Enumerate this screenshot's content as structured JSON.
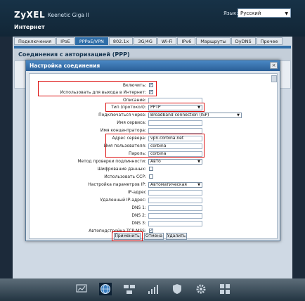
{
  "header": {
    "brand": "ZyXEL",
    "model": "Keenetic Giga II",
    "section": "Интернет",
    "language_label": "Язык:",
    "language_value": "Русский"
  },
  "tabs": [
    {
      "label": "Подключения",
      "active": false
    },
    {
      "label": "IPoE",
      "active": false
    },
    {
      "label": "PPPoE/VPN",
      "active": true
    },
    {
      "label": "802.1x",
      "active": false
    },
    {
      "label": "3G/4G",
      "active": false
    },
    {
      "label": "Wi-Fi",
      "active": false
    },
    {
      "label": "IPv6",
      "active": false
    },
    {
      "label": "Маршруты",
      "active": false
    },
    {
      "label": "DyDNS",
      "active": false
    },
    {
      "label": "Прочее",
      "active": false
    }
  ],
  "panel_title": "Соединения с авторизацией (PPP)",
  "dialog": {
    "title": "Настройка соединения",
    "close": "×",
    "fields": {
      "enable": {
        "label": "Включить:",
        "checked": true
      },
      "use_for_internet": {
        "label": "Использовать для выхода в Интернет:",
        "checked": true
      },
      "description": {
        "label": "Описание:",
        "value": ""
      },
      "protocol": {
        "label": "Тип (протокол):",
        "value": "PPTP"
      },
      "connect_via": {
        "label": "Подключаться через:",
        "value": "Broadband connection (ISP)"
      },
      "service_name": {
        "label": "Имя сервиса:",
        "value": ""
      },
      "concentrator_name": {
        "label": "Имя концентратора:",
        "value": ""
      },
      "server_address": {
        "label": "Адрес сервера:",
        "value": "vpn.corbina.net"
      },
      "username": {
        "label": "Имя пользователя:",
        "value": "corbina"
      },
      "password": {
        "label": "Пароль:",
        "value": "corbina"
      },
      "auth_method": {
        "label": "Метод проверки подлинности:",
        "value": "Авто"
      },
      "encryption": {
        "label": "Шифрование данных:",
        "checked": false
      },
      "use_ccp": {
        "label": "Использовать CCP:",
        "checked": false
      },
      "ip_settings": {
        "label": "Настройка параметров IP:",
        "value": "Автоматическая"
      },
      "ip_address": {
        "label": "IP-адрес",
        "value": ""
      },
      "remote_ip": {
        "label": "Удаленный IP-адрес:",
        "value": ""
      },
      "dns1": {
        "label": "DNS 1:",
        "value": ""
      },
      "dns2": {
        "label": "DNS 2:",
        "value": ""
      },
      "dns3": {
        "label": "DNS 3:",
        "value": ""
      },
      "tcp_mss": {
        "label": "Автоподстройка TCP-MSS:",
        "checked": true
      }
    },
    "buttons": {
      "apply": "Применить",
      "cancel": "Отмена",
      "delete": "Удалить"
    }
  },
  "taskbar": [
    "monitor-icon",
    "globe-icon",
    "network-icon",
    "signal-icon",
    "shield-icon",
    "gear-icon",
    "apps-grid-icon"
  ],
  "colors": {
    "highlight": "#dd1111",
    "accent": "#2f6ea8"
  }
}
